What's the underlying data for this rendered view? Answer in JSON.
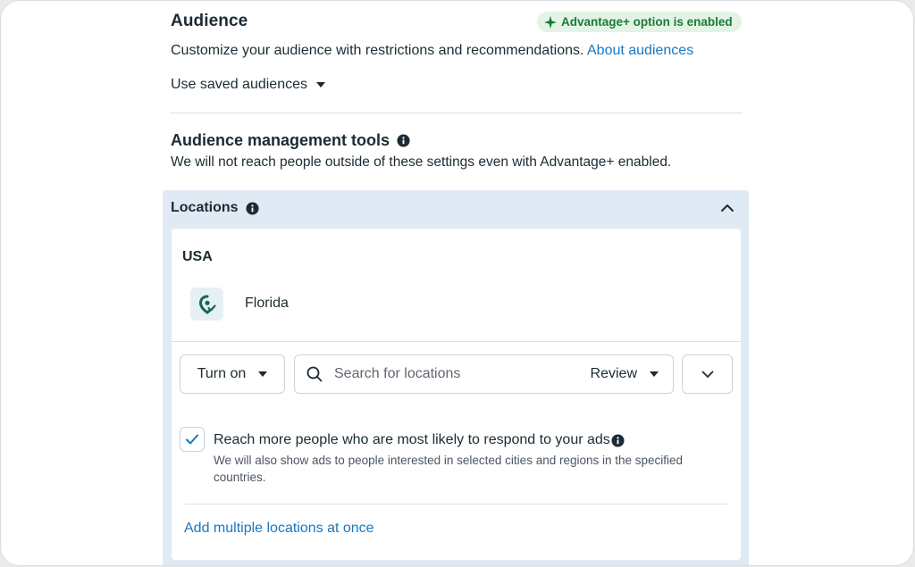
{
  "audience": {
    "title": "Audience",
    "advantage_badge": "Advantage+ option is enabled",
    "description": "Customize your audience with restrictions and recommendations.",
    "about_link": "About audiences",
    "saved_audiences": "Use saved audiences"
  },
  "management": {
    "title": "Audience management tools",
    "description": "We will not reach people outside of these settings even with Advantage+ enabled."
  },
  "locations": {
    "title": "Locations",
    "country": "USA",
    "selected": [
      {
        "name": "Florida",
        "icon": "location-pin-icon"
      }
    ],
    "mode_button": "Turn on",
    "search_placeholder": "Search for locations",
    "review_label": "Review",
    "reach_more": {
      "checked": true,
      "label": "Reach more people who are most likely to respond to your ads",
      "sublabel": "We will also show ads to people interested in selected cities and regions in the specified countries."
    },
    "add_multiple_link": "Add multiple locations at once"
  },
  "colors": {
    "link": "#1877c2",
    "badge_bg": "#e3f4e6",
    "badge_text": "#1c7a37",
    "panel_bg": "#dfeaf5",
    "text": "#1c2b33"
  }
}
